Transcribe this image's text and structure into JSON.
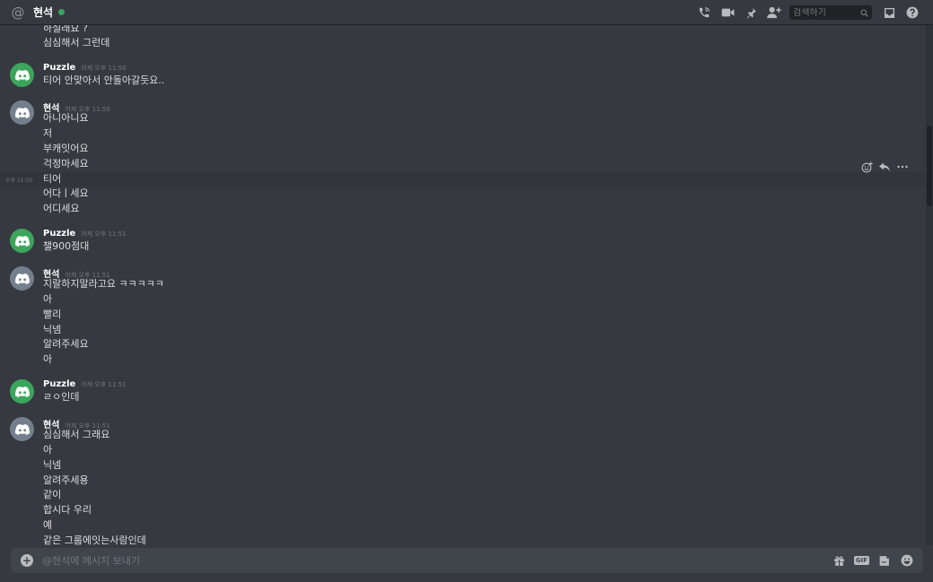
{
  "header": {
    "title": "현석",
    "at_symbol": "@",
    "search_placeholder": "검색하기"
  },
  "hover": {
    "time": "오후 11:50"
  },
  "messages": [
    {
      "lines": [
        "하실래요 ?",
        "심심해서 그런데"
      ]
    },
    {
      "author": "Puzzle",
      "time": "어제 오후 11:50",
      "avatar": "green",
      "lines": [
        "티어 안맞아서 안돌아갈듯요.."
      ]
    },
    {
      "author": "현석",
      "time": "어제 오후 11:50",
      "avatar": "grey",
      "lines": [
        "아니아니요",
        "저",
        "부캐잇어요",
        "걱정마세요",
        "티어",
        "어다ㅣ세요",
        "어디세요"
      ]
    },
    {
      "author": "Puzzle",
      "time": "어제 오후 11:51",
      "avatar": "green",
      "lines": [
        "챌900점대"
      ]
    },
    {
      "author": "현석",
      "time": "어제 오후 11:51",
      "avatar": "grey",
      "lines": [
        "지랄하지말라고요 ㅋㅋㅋㅋㅋ",
        "아",
        "빨리",
        "닉넴",
        "알려주세요",
        "아"
      ]
    },
    {
      "author": "Puzzle",
      "time": "어제 오후 11:51",
      "avatar": "green",
      "lines": [
        "ㄹㅇ인데"
      ]
    },
    {
      "author": "현석",
      "time": "어제 오후 11:51",
      "avatar": "grey",
      "lines": [
        "심심해서 그래요",
        "아",
        "닉넴",
        "알려주세용",
        "같이",
        "합시다 우리",
        "예",
        "같은 그룹에잇는사람인데"
      ]
    }
  ],
  "composer": {
    "placeholder": "@현석에 메시지 보내기",
    "gif_label": "GIF"
  }
}
